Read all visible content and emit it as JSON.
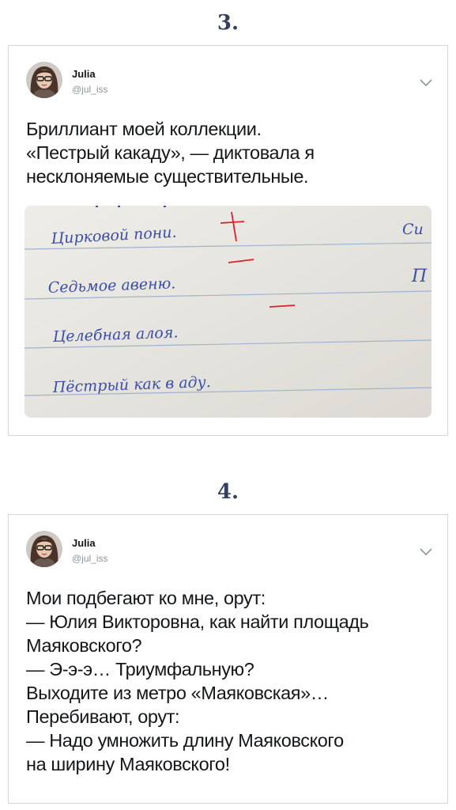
{
  "tweets": [
    {
      "number": "3.",
      "author": {
        "name": "Julia",
        "handle": "@jul_iss"
      },
      "lines": [
        "Бриллиант моей коллекции.",
        "«Пестрый какаду», — диктовала я",
        "несклоняемые существительные."
      ],
      "photo": {
        "handwriting": [
          "Цирковой пони.",
          "Седьмое авеню.",
          "Целебная алоя.",
          "Пёстрый как в аду.",
          "Си",
          "П"
        ]
      }
    },
    {
      "number": "4.",
      "author": {
        "name": "Julia",
        "handle": "@jul_iss"
      },
      "lines": [
        "Мои подбегают ко мне, орут:",
        "— Юлия Викторовна, как найти площадь",
        "Маяковского?",
        "— Э-э-э… Триумфальную?",
        "Выходите из метро «Маяковская»…",
        "Перебивают, орут:",
        "— Надо умножить длину Маяковского",
        "на ширину Маяковского!"
      ]
    }
  ],
  "colors": {
    "number": "#34405e",
    "card_border": "#d6d6d6",
    "handle": "#8a959e",
    "ink_red": "#d8222c",
    "ink_blue": "#3c4ea8"
  },
  "icons": [
    "avatar",
    "chevron-down-icon"
  ]
}
